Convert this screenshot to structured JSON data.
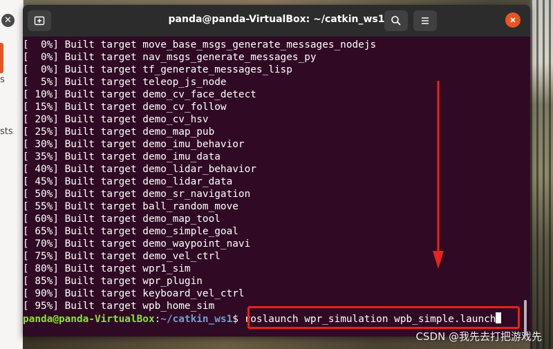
{
  "window": {
    "title": "panda@panda-VirtualBox: ~/catkin_ws1",
    "icons": [
      "new-tab-icon",
      "search-icon",
      "hamburger-menu-icon",
      "close-icon"
    ]
  },
  "terminal": {
    "lines": [
      "[  0%] Built target move_base_msgs_generate_messages_nodejs",
      "[  0%] Built target nav_msgs_generate_messages_py",
      "[  0%] Built target tf_generate_messages_lisp",
      "[  5%] Built target teleop_js_node",
      "[ 10%] Built target demo_cv_face_detect",
      "[ 15%] Built target demo_cv_follow",
      "[ 20%] Built target demo_cv_hsv",
      "[ 25%] Built target demo_map_pub",
      "[ 30%] Built target demo_imu_behavior",
      "[ 35%] Built target demo_imu_data",
      "[ 40%] Built target demo_lidar_behavior",
      "[ 45%] Built target demo_lidar_data",
      "[ 50%] Built target demo_sr_navigation",
      "[ 55%] Built target ball_random_move",
      "[ 60%] Built target demo_map_tool",
      "[ 65%] Built target demo_simple_goal",
      "[ 70%] Built target demo_waypoint_navi",
      "[ 75%] Built target demo_vel_ctrl",
      "[ 80%] Built target wpr1_sim",
      "[ 85%] Built target wpr_plugin",
      "[ 90%] Built target keyboard_vel_ctrl",
      "[ 95%] Built target wpb_home_sim"
    ],
    "prompt_user_host": "panda@panda-VirtualBox",
    "prompt_sep": ":",
    "prompt_path": "~/catkin_ws1",
    "prompt_symbol": "$ ",
    "command": "roslaunch wpr_simulation wpb_simple.launch"
  },
  "background": {
    "left_fragments": [
      "s",
      "sts"
    ],
    "watermark": "CSDN @我先去打把游戏先"
  },
  "colors": {
    "terminal_bg": "#300a24",
    "titlebar_bg": "#2c2c2c",
    "prompt_green": "#8ae234",
    "prompt_blue": "#729fcf",
    "close_orange": "#e95420",
    "annotation_red": "#e8221c"
  }
}
